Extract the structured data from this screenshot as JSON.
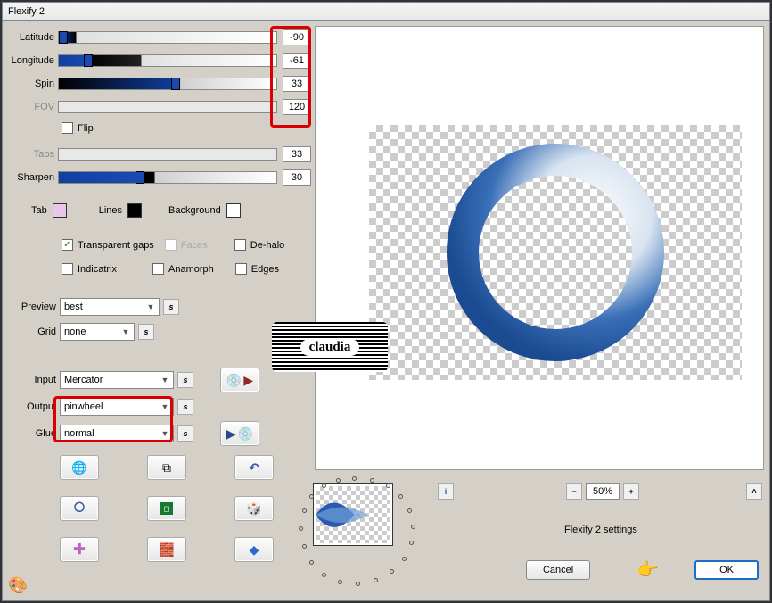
{
  "window": {
    "title": "Flexify 2"
  },
  "sliders": {
    "latitude": {
      "label": "Latitude",
      "value": "-90"
    },
    "longitude": {
      "label": "Longitude",
      "value": "-61"
    },
    "spin": {
      "label": "Spin",
      "value": "33"
    },
    "fov": {
      "label": "FOV",
      "value": "120"
    },
    "tabs": {
      "label": "Tabs",
      "value": "33"
    },
    "sharpen": {
      "label": "Sharpen",
      "value": "30"
    }
  },
  "flip": {
    "label": "Flip"
  },
  "swatches": {
    "tab": {
      "label": "Tab",
      "color": "#e8c6e8"
    },
    "lines": {
      "label": "Lines",
      "color": "#000000"
    },
    "background": {
      "label": "Background",
      "color": "#ffffff"
    }
  },
  "checks": {
    "transparent_gaps": {
      "label": "Transparent gaps",
      "checked": true
    },
    "faces": {
      "label": "Faces",
      "checked": false,
      "disabled": true
    },
    "dehalo": {
      "label": "De-halo",
      "checked": false
    },
    "indicatrix": {
      "label": "Indicatrix",
      "checked": false
    },
    "anamorph": {
      "label": "Anamorph",
      "checked": false
    },
    "edges": {
      "label": "Edges",
      "checked": false
    }
  },
  "combos": {
    "preview": {
      "label": "Preview",
      "value": "best"
    },
    "grid": {
      "label": "Grid",
      "value": "none"
    },
    "input": {
      "label": "Input",
      "value": "Mercator"
    },
    "output": {
      "label": "Output",
      "value": "pinwheel"
    },
    "glue": {
      "label": "Glue",
      "value": "normal"
    }
  },
  "bottom": {
    "zoom": "50%",
    "settings_label": "Flexify 2 settings",
    "cancel": "Cancel",
    "ok": "OK"
  }
}
